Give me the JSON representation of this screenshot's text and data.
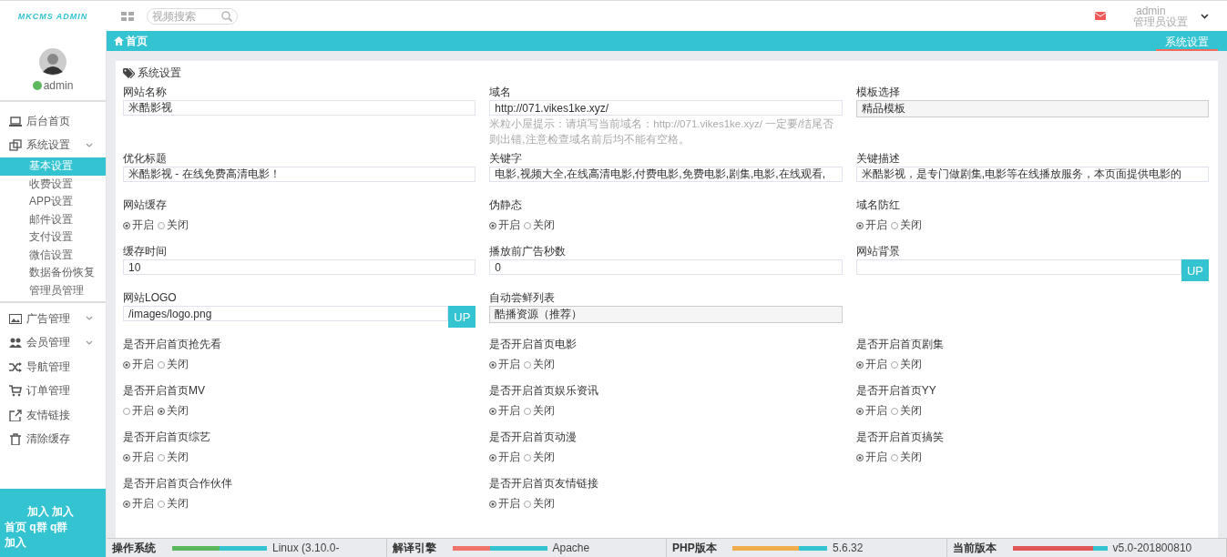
{
  "logo": "MKCMS ADMIN",
  "search": {
    "placeholder": "视频搜索"
  },
  "user_menu": {
    "name": "admin",
    "role": "管理员设置"
  },
  "sidebar": {
    "user": {
      "name": "admin",
      "online": true
    },
    "items": [
      {
        "kind": "link",
        "label": "后台首页",
        "selected": false
      },
      {
        "kind": "group",
        "label": "系统设置",
        "expanded": true,
        "selected": false,
        "children": [
          {
            "label": "基本设置",
            "selected": true
          },
          {
            "label": "收费设置",
            "selected": false
          },
          {
            "label": "APP设置",
            "selected": false
          },
          {
            "label": "邮件设置",
            "selected": false
          },
          {
            "label": "支付设置",
            "selected": false
          },
          {
            "label": "微信设置",
            "selected": false
          },
          {
            "label": "数据备份恢复",
            "selected": false
          },
          {
            "label": "管理员管理",
            "selected": false
          }
        ]
      },
      {
        "kind": "group",
        "label": "广告管理",
        "selected": false
      },
      {
        "kind": "group",
        "label": "会员管理",
        "selected": false
      },
      {
        "kind": "link",
        "label": "导航管理",
        "selected": false
      },
      {
        "kind": "link",
        "label": "订单管理",
        "selected": false
      },
      {
        "kind": "link",
        "label": "友情链接",
        "selected": false
      },
      {
        "kind": "link",
        "label": "清除缓存",
        "selected": false
      }
    ],
    "footer_lines": [
      "加入 加入",
      "首页 q群 q群",
      "加入"
    ]
  },
  "breadcrumb": "首页",
  "tabs": [
    {
      "label": "系统设置",
      "selected": true
    }
  ],
  "panel": {
    "title": "系统设置",
    "fields": [
      {
        "kind": "text",
        "label": "网站名称",
        "value": "米酷影视"
      },
      {
        "kind": "text",
        "label": "域名",
        "value": "http://071.vikes1ke.xyz/",
        "hint": "米粒小屋提示：请填写当前域名：http://071.vikes1ke.xyz/ 一定要/结尾否则出错,注意检查域名前后均不能有空格。"
      },
      {
        "kind": "select",
        "label": "模板选择",
        "value": "精品模板"
      },
      {
        "kind": "text",
        "label": "优化标题",
        "value": "米酷影视 - 在线免费高清电影！"
      },
      {
        "kind": "text",
        "label": "关键字",
        "value": "电影,视频大全,在线高清电影,付费电影,免费电影,剧集,电影,在线观看,"
      },
      {
        "kind": "text",
        "label": "关键描述",
        "value": "米酷影视，是专门做剧集,电影等在线播放服务，本页面提供电影的"
      },
      {
        "kind": "radio",
        "label": "网站缓存",
        "options": [
          {
            "label": "开启",
            "selected": true
          },
          {
            "label": "关闭",
            "selected": false
          }
        ]
      },
      {
        "kind": "radio",
        "label": "伪静态",
        "options": [
          {
            "label": "开启",
            "selected": true
          },
          {
            "label": "关闭",
            "selected": false
          }
        ]
      },
      {
        "kind": "radio",
        "label": "域名防红",
        "options": [
          {
            "label": "开启",
            "selected": true
          },
          {
            "label": "关闭",
            "selected": false
          }
        ]
      },
      {
        "kind": "text",
        "label": "缓存时间",
        "value": "10"
      },
      {
        "kind": "text",
        "label": "播放前广告秒数",
        "value": "0"
      },
      {
        "kind": "upload",
        "label": "网站背景",
        "button": "UP"
      },
      {
        "kind": "upload",
        "label": "网站LOGO",
        "value": "/images/logo.png",
        "button": "UP"
      },
      {
        "kind": "select",
        "label": "自动尝鲜列表",
        "value": "酷播资源（推荐）"
      },
      {
        "kind": "empty"
      },
      {
        "kind": "radio",
        "label": "是否开启首页抢先看",
        "options": [
          {
            "label": "开启",
            "selected": true
          },
          {
            "label": "关闭",
            "selected": false
          }
        ]
      },
      {
        "kind": "radio",
        "label": "是否开启首页电影",
        "options": [
          {
            "label": "开启",
            "selected": true
          },
          {
            "label": "关闭",
            "selected": false
          }
        ]
      },
      {
        "kind": "radio",
        "label": "是否开启首页剧集",
        "options": [
          {
            "label": "开启",
            "selected": true
          },
          {
            "label": "关闭",
            "selected": false
          }
        ]
      },
      {
        "kind": "radio",
        "label": "是否开启首页MV",
        "options": [
          {
            "label": "开启",
            "selected": false
          },
          {
            "label": "关闭",
            "selected": true
          }
        ]
      },
      {
        "kind": "radio",
        "label": "是否开启首页娱乐资讯",
        "options": [
          {
            "label": "开启",
            "selected": true
          },
          {
            "label": "关闭",
            "selected": false
          }
        ]
      },
      {
        "kind": "radio",
        "label": "是否开启首页YY",
        "options": [
          {
            "label": "开启",
            "selected": true
          },
          {
            "label": "关闭",
            "selected": false
          }
        ]
      },
      {
        "kind": "radio",
        "label": "是否开启首页综艺",
        "options": [
          {
            "label": "开启",
            "selected": true
          },
          {
            "label": "关闭",
            "selected": false
          }
        ]
      },
      {
        "kind": "radio",
        "label": "是否开启首页动漫",
        "options": [
          {
            "label": "开启",
            "selected": true
          },
          {
            "label": "关闭",
            "selected": false
          }
        ]
      },
      {
        "kind": "radio",
        "label": "是否开启首页搞笑",
        "options": [
          {
            "label": "开启",
            "selected": true
          },
          {
            "label": "关闭",
            "selected": false
          }
        ]
      },
      {
        "kind": "radio",
        "label": "是否开启首页合作伙伴",
        "options": [
          {
            "label": "开启",
            "selected": true
          },
          {
            "label": "关闭",
            "selected": false
          }
        ]
      },
      {
        "kind": "radio",
        "label": "是否开启首页友情链接",
        "options": [
          {
            "label": "开启",
            "selected": true
          },
          {
            "label": "关闭",
            "selected": false
          }
        ]
      }
    ]
  },
  "status_bar": [
    {
      "label": "操作系统",
      "value": "Linux (3.10.0-",
      "level": 0.5,
      "color": "#5cb85c"
    },
    {
      "label": "解译引擎",
      "value": "Apache",
      "level": 0.4,
      "color": "#f0736a"
    },
    {
      "label": "PHP版本",
      "value": "5.6.32",
      "level": 0.7,
      "color": "#f0ad4e"
    },
    {
      "label": "当前版本",
      "value": "v5.0-201800810",
      "level": 0.85,
      "color": "#e05656"
    }
  ]
}
